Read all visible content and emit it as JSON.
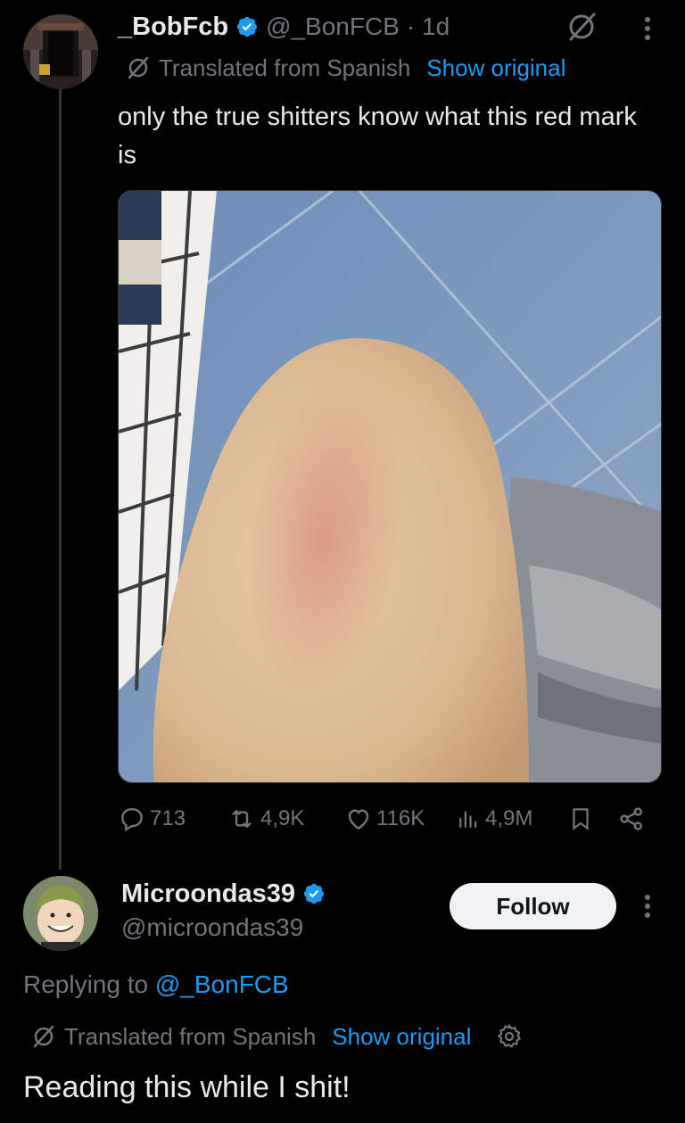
{
  "tweet": {
    "author": {
      "display_name": "_BobFcb",
      "handle": "@_BonFCB",
      "time": "· 1d",
      "verified": true
    },
    "translation": {
      "label": "Translated from Spanish",
      "show_original": "Show original"
    },
    "text": "only the true shitters know what this red mark is",
    "media": {
      "type": "photo"
    },
    "stats": {
      "replies": "713",
      "retweets": "4,9K",
      "likes": "116K",
      "views": "4,9M"
    }
  },
  "reply": {
    "author": {
      "display_name": "Microondas39",
      "handle": "@microondas39",
      "verified": true
    },
    "follow_label": "Follow",
    "replying_to_prefix": "Replying to",
    "replying_to_handle": "@_BonFCB",
    "translation": {
      "label": "Translated from Spanish",
      "show_original": "Show original"
    },
    "text": "Reading this while I shit!"
  },
  "colors": {
    "background": "#000000",
    "text_primary": "#e7e9ea",
    "text_secondary": "#71767b",
    "accent": "#1d9bf0",
    "verified": "#1d9bf0"
  },
  "icons": [
    "verified-badge-icon",
    "grok-translate-icon",
    "more-options-icon",
    "reply-icon",
    "retweet-icon",
    "like-icon",
    "views-icon",
    "bookmark-icon",
    "share-icon",
    "settings-gear-icon"
  ]
}
